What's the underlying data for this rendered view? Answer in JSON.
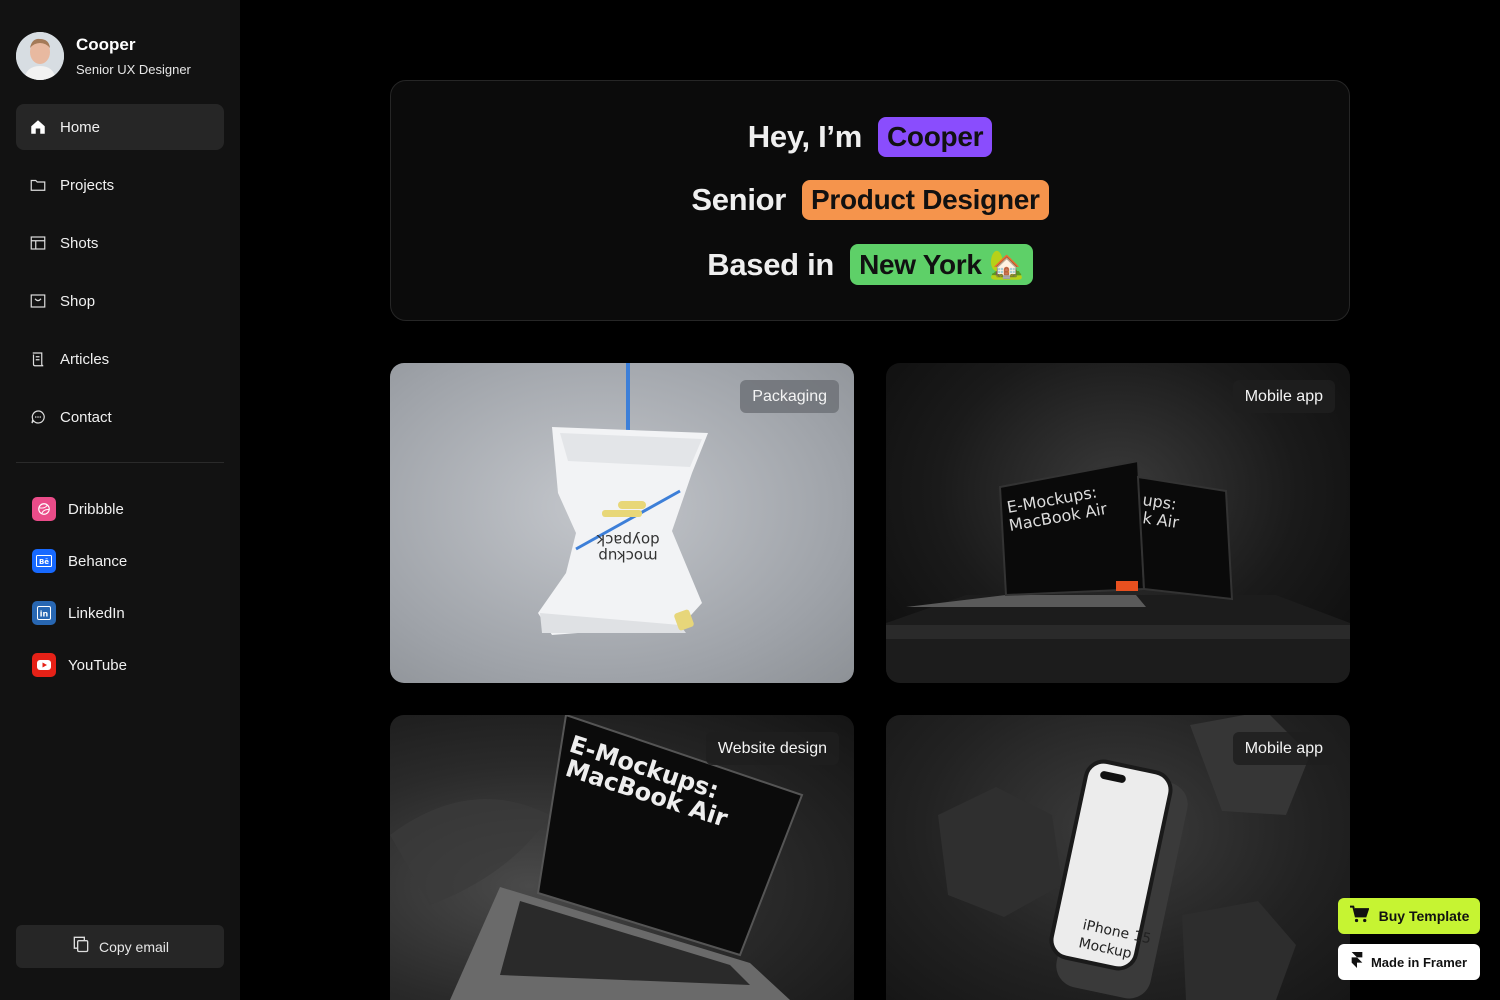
{
  "profile": {
    "name": "Cooper",
    "role": "Senior UX Designer"
  },
  "nav": [
    {
      "label": "Home",
      "icon": "home-icon",
      "active": true
    },
    {
      "label": "Projects",
      "icon": "folder-icon"
    },
    {
      "label": "Shots",
      "icon": "layout-icon"
    },
    {
      "label": "Shop",
      "icon": "shop-icon"
    },
    {
      "label": "Articles",
      "icon": "scroll-icon"
    },
    {
      "label": "Contact",
      "icon": "chat-icon"
    }
  ],
  "social": [
    {
      "label": "Dribbble",
      "icon": "dribbble-icon",
      "color": "#ea4c89"
    },
    {
      "label": "Behance",
      "icon": "behance-icon",
      "color": "#1769ff"
    },
    {
      "label": "LinkedIn",
      "icon": "linkedin-icon",
      "color": "#2867b2"
    },
    {
      "label": "YouTube",
      "icon": "youtube-icon",
      "color": "#e62117"
    }
  ],
  "copy_email": {
    "label": "Copy email",
    "icon": "copy-icon"
  },
  "hero": {
    "line1_prefix": "Hey, I’m",
    "line1_pill": "Cooper",
    "line2_prefix": "Senior",
    "line2_pill": "Product Designer",
    "line3_prefix": "Based in",
    "line3_pill": "New York 🏡",
    "colors": {
      "purple": "#8a4dfd",
      "orange": "#f5944c",
      "green": "#5ed068"
    }
  },
  "cards": [
    {
      "tag": "Packaging",
      "image": "doypack-pouch-mockup",
      "mock_text": [
        "doypack",
        "mockup"
      ]
    },
    {
      "tag": "Mobile app",
      "image": "macbook-air-mockups-dark",
      "mock_text": [
        "E-Mockups:",
        "MacBook Air",
        "ups:",
        "k Air"
      ]
    },
    {
      "tag": "Website design",
      "image": "macbook-air-silk",
      "mock_text": [
        "E-Mockups:",
        "MacBook Air"
      ]
    },
    {
      "tag": "Mobile app",
      "image": "iphone-15-rocks",
      "mock_text": [
        "iPhone 15",
        "Mockup"
      ]
    }
  ],
  "buy_template": {
    "label": "Buy Template",
    "icon": "cart-icon",
    "color": "#c6f432"
  },
  "made_in_framer": {
    "label": "Made in Framer",
    "icon": "framer-icon"
  }
}
